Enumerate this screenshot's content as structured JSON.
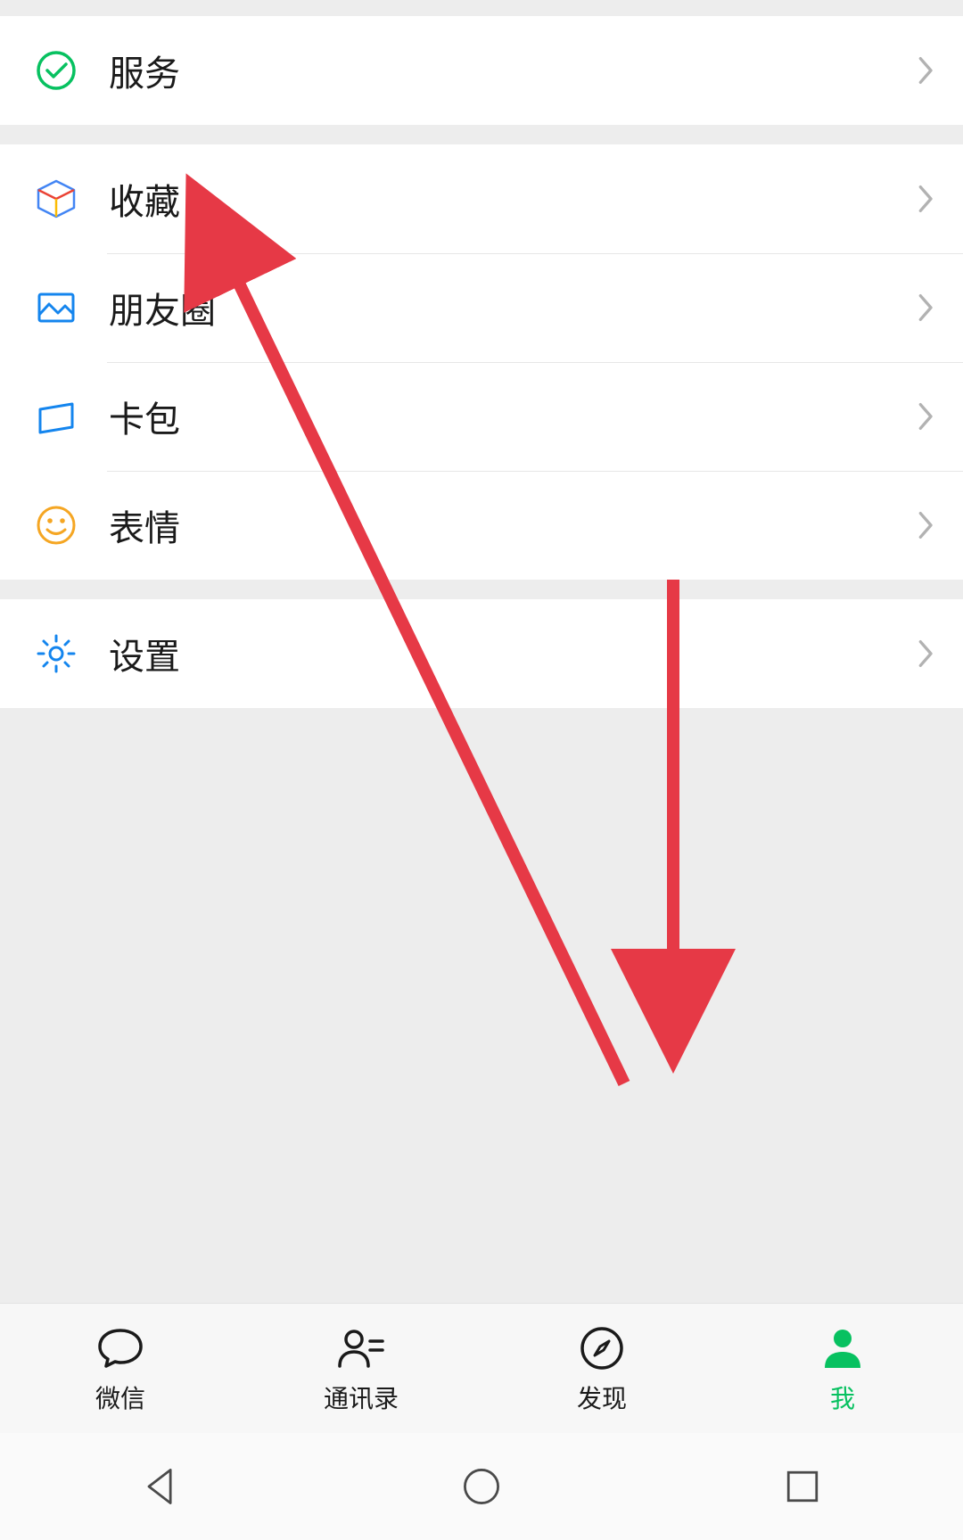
{
  "sections": [
    {
      "items": [
        {
          "key": "services",
          "label": "服务"
        }
      ]
    },
    {
      "items": [
        {
          "key": "favorites",
          "label": "收藏"
        },
        {
          "key": "moments",
          "label": "朋友圈"
        },
        {
          "key": "cards",
          "label": "卡包"
        },
        {
          "key": "stickers",
          "label": "表情"
        }
      ]
    },
    {
      "items": [
        {
          "key": "settings",
          "label": "设置"
        }
      ]
    }
  ],
  "tabs": {
    "chats": "微信",
    "contacts": "通讯录",
    "discover": "发现",
    "me": "我"
  },
  "colors": {
    "accent": "#07c160",
    "arrow": "#e63946"
  }
}
